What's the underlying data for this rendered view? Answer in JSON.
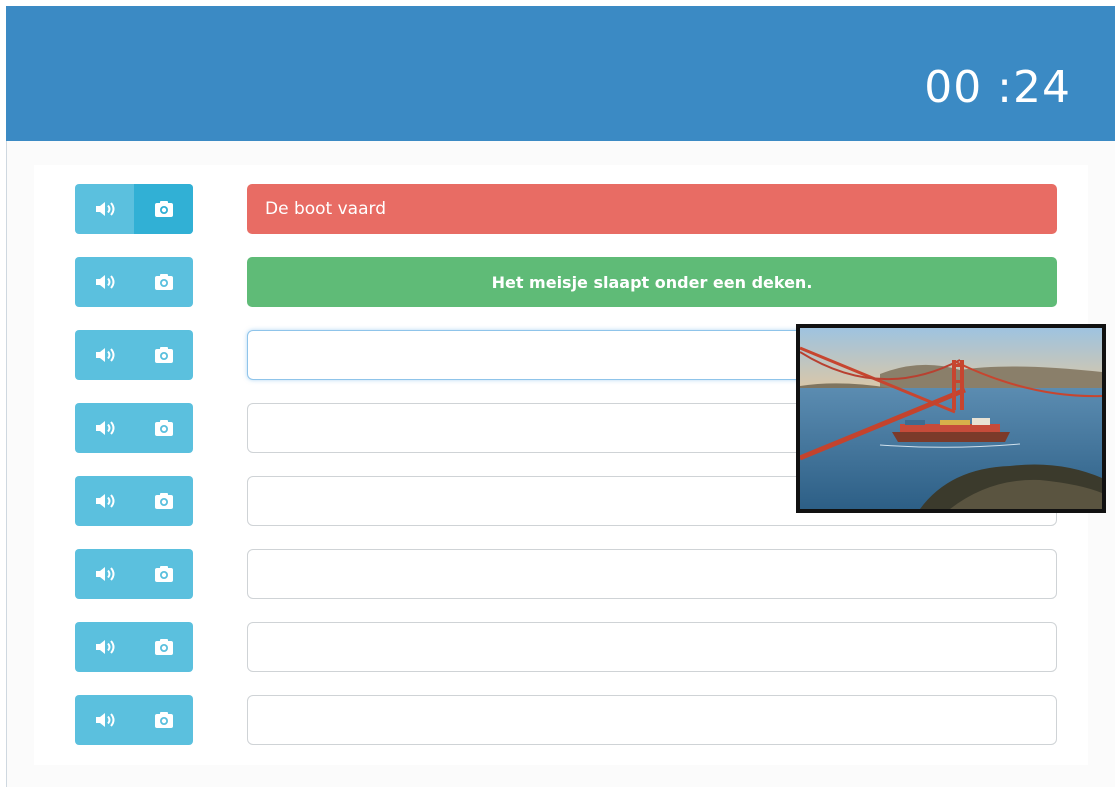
{
  "header": {
    "timer": "00 :24",
    "color": "#3b8ac4"
  },
  "rows": [
    {
      "status": "wrong",
      "text": "De boot vaard"
    },
    {
      "status": "correct",
      "text": "Het meisje slaapt onder een deken."
    },
    {
      "status": "input",
      "value": "",
      "focused": true
    },
    {
      "status": "input",
      "value": ""
    },
    {
      "status": "input",
      "value": ""
    },
    {
      "status": "input",
      "value": ""
    },
    {
      "status": "input",
      "value": ""
    },
    {
      "status": "input",
      "value": ""
    }
  ],
  "icons": {
    "audio": "speaker-icon",
    "image": "camera-icon"
  },
  "colors": {
    "wrong": "#e86c64",
    "correct": "#5fbb77",
    "button": "#5bc0de"
  },
  "popup_image": {
    "subject": "Golden Gate bridge with container ship"
  }
}
